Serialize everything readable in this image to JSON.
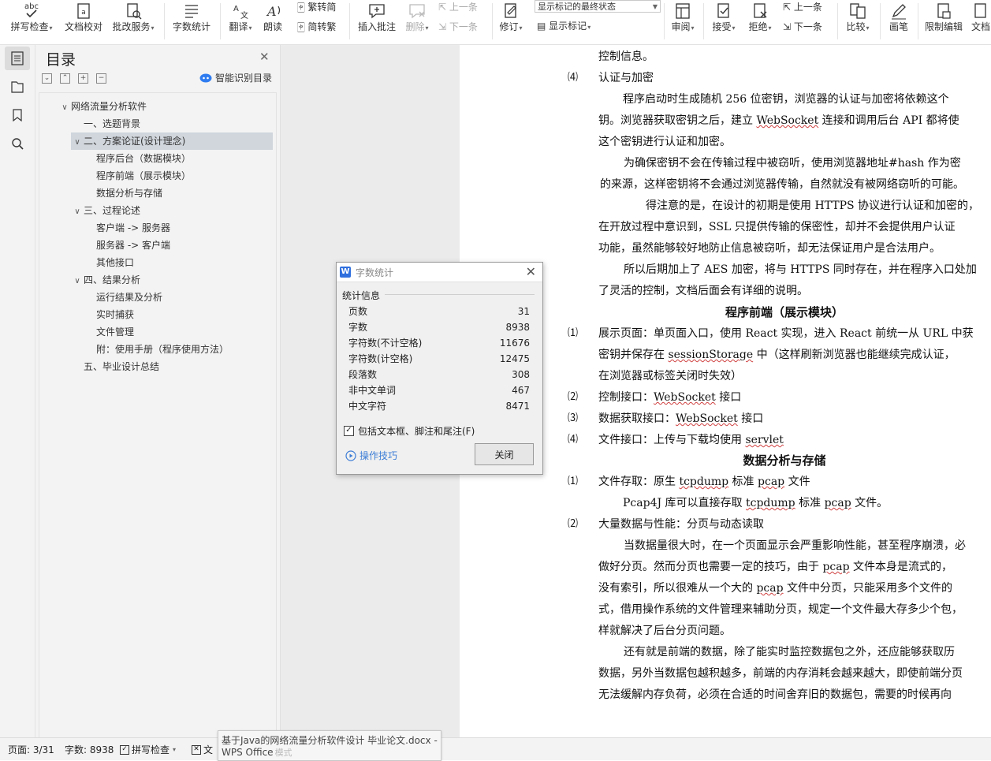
{
  "ribbon": {
    "spell_check": "拼写检查",
    "doc_proof": "文档校对",
    "annotate_service": "批改服务",
    "word_count": "字数统计",
    "translate": "翻译",
    "read_aloud": "朗读",
    "trad_simp": "繁转简",
    "simp_trad": "简转繁",
    "insert_comment": "插入批注",
    "delete": "删除",
    "prev_comment": "上一条",
    "next_comment": "下一条",
    "revise": "修订",
    "markup_select": "显示标记的最终状态",
    "show_markup": "显示标记",
    "review": "审阅",
    "accept": "接受",
    "reject": "拒绝",
    "prev_change": "上一条",
    "next_change": "下一条",
    "compare": "比较",
    "ink": "画笔",
    "restrict": "限制编辑",
    "doc": "文档"
  },
  "toc": {
    "title": "目录",
    "smart_detect": "智能识别目录",
    "items": [
      {
        "label": "网络流量分析软件",
        "level": 0,
        "toggle": "∨"
      },
      {
        "label": "一、选题背景",
        "level": 1,
        "toggle": ""
      },
      {
        "label": "二、方案论证(设计理念)",
        "level": 1,
        "toggle": "∨",
        "selected": true
      },
      {
        "label": "程序后台（数据模块）",
        "level": 2,
        "toggle": ""
      },
      {
        "label": "程序前端（展示模块）",
        "level": 2,
        "toggle": ""
      },
      {
        "label": "数据分析与存储",
        "level": 2,
        "toggle": ""
      },
      {
        "label": "三、过程论述",
        "level": 1,
        "toggle": "∨"
      },
      {
        "label": "客户端 -> 服务器",
        "level": 2,
        "toggle": ""
      },
      {
        "label": "服务器 -> 客户端",
        "level": 2,
        "toggle": ""
      },
      {
        "label": "其他接口",
        "level": 2,
        "toggle": ""
      },
      {
        "label": "四、结果分析",
        "level": 1,
        "toggle": "∨"
      },
      {
        "label": "运行结果及分析",
        "level": 2,
        "toggle": ""
      },
      {
        "label": "实时捕获",
        "level": 2,
        "toggle": ""
      },
      {
        "label": "文件管理",
        "level": 2,
        "toggle": ""
      },
      {
        "label": "附：使用手册（程序使用方法）",
        "level": 2,
        "toggle": ""
      },
      {
        "label": "五、毕业设计总结",
        "level": 1,
        "toggle": ""
      }
    ]
  },
  "dialog": {
    "title": "字数统计",
    "section": "统计信息",
    "stats": [
      {
        "label": "页数",
        "value": "31"
      },
      {
        "label": "字数",
        "value": "8938"
      },
      {
        "label": "字符数(不计空格)",
        "value": "11676"
      },
      {
        "label": "字符数(计空格)",
        "value": "12475"
      },
      {
        "label": "段落数",
        "value": "308"
      },
      {
        "label": "非中文单词",
        "value": "467"
      },
      {
        "label": "中文字符",
        "value": "8471"
      }
    ],
    "include_label": "包括文本框、脚注和尾注(F)",
    "include_checked": true,
    "tips": "操作技巧",
    "close": "关闭"
  },
  "document": {
    "lines": [
      {
        "text": "控制信息。",
        "num": ""
      },
      {
        "text": "认证与加密",
        "num": "⑷"
      },
      {
        "text": "程序启动时生成随机 256 位密钥，浏览器的认证与加密将依赖这个",
        "num": ""
      },
      {
        "text": "钥。浏览器获取密钥之后，建立 WebSocket 连接和调用后台 API 都将使",
        "num": ""
      },
      {
        "text": "这个密钥进行认证和加密。",
        "num": ""
      },
      {
        "text": "为确保密钥不会在传输过程中被窃听，使用浏览器地址#hash 作为密",
        "num": ""
      },
      {
        "text": "的来源，这样密钥将不会通过浏览器传输，自然就没有被网络窃听的可能。",
        "num": ""
      },
      {
        "text": "得注意的是，在设计的初期是使用 HTTPS 协议进行认证和加密的，",
        "num": ""
      },
      {
        "text": "在开放过程中意识到，SSL 只提供传输的保密性，却并不会提供用户认证",
        "num": ""
      },
      {
        "text": "功能，虽然能够较好地防止信息被窃听，却无法保证用户是合法用户。",
        "num": ""
      },
      {
        "text": "所以后期加上了 AES 加密，将与 HTTPS 同时存在，并在程序入口处加",
        "num": ""
      },
      {
        "text": "了灵活的控制，文档后面会有详细的说明。",
        "num": ""
      },
      {
        "text": "程序前端（展示模块）",
        "num": ""
      },
      {
        "text": "展示页面：单页面入口，使用 React 实现，进入 React 前统一从 URL 中获",
        "num": "⑴"
      },
      {
        "text": "密钥并保存在 sessionStorage 中（这样刷新浏览器也能继续完成认证，",
        "num": ""
      },
      {
        "text": "在浏览器或标签关闭时失效）",
        "num": ""
      },
      {
        "text": "控制接口：WebSocket 接口",
        "num": "⑵"
      },
      {
        "text": "数据获取接口：WebSocket 接口",
        "num": "⑶"
      },
      {
        "text": "文件接口：上传与下载均使用 servlet",
        "num": "⑷"
      },
      {
        "text": "数据分析与存储",
        "num": ""
      },
      {
        "text": "文件存取：原生 tcpdump 标准 pcap 文件",
        "num": "⑴"
      },
      {
        "text": "Pcap4J 库可以直接存取 tcpdump 标准 pcap 文件。",
        "num": ""
      },
      {
        "text": "大量数据与性能：分页与动态读取",
        "num": "⑵"
      },
      {
        "text": "当数据量很大时，在一个页面显示会严重影响性能，甚至程序崩溃，必",
        "num": ""
      },
      {
        "text": "做好分页。然而分页也需要一定的技巧，由于 pcap 文件本身是流式的，",
        "num": ""
      },
      {
        "text": "没有索引，所以很难从一个大的 pcap 文件中分页，只能采用多个文件的",
        "num": ""
      },
      {
        "text": "式，借用操作系统的文件管理来辅助分页，规定一个文件最大存多少个包，",
        "num": ""
      },
      {
        "text": "样就解决了后台分页问题。",
        "num": ""
      },
      {
        "text": "还有就是前端的数据，除了能实时监控数据包之外，还应能够获取历",
        "num": ""
      },
      {
        "text": "数据，另外当数据包越积越多，前端的内存消耗会越来越大，即使前端分页",
        "num": ""
      },
      {
        "text": "无法缓解内存负荷，必须在合适的时间舍弃旧的数据包，需要的时候再向",
        "num": ""
      }
    ]
  },
  "status": {
    "page": "页面: 3/31",
    "words": "字数: 8938",
    "spell": "拼写检查",
    "doc_partial": "文",
    "tooltip_file": "基于Java的网络流量分析软件设计 毕业论文.docx -",
    "tooltip_app": "WPS Office",
    "tooltip_hidden": "模式"
  }
}
